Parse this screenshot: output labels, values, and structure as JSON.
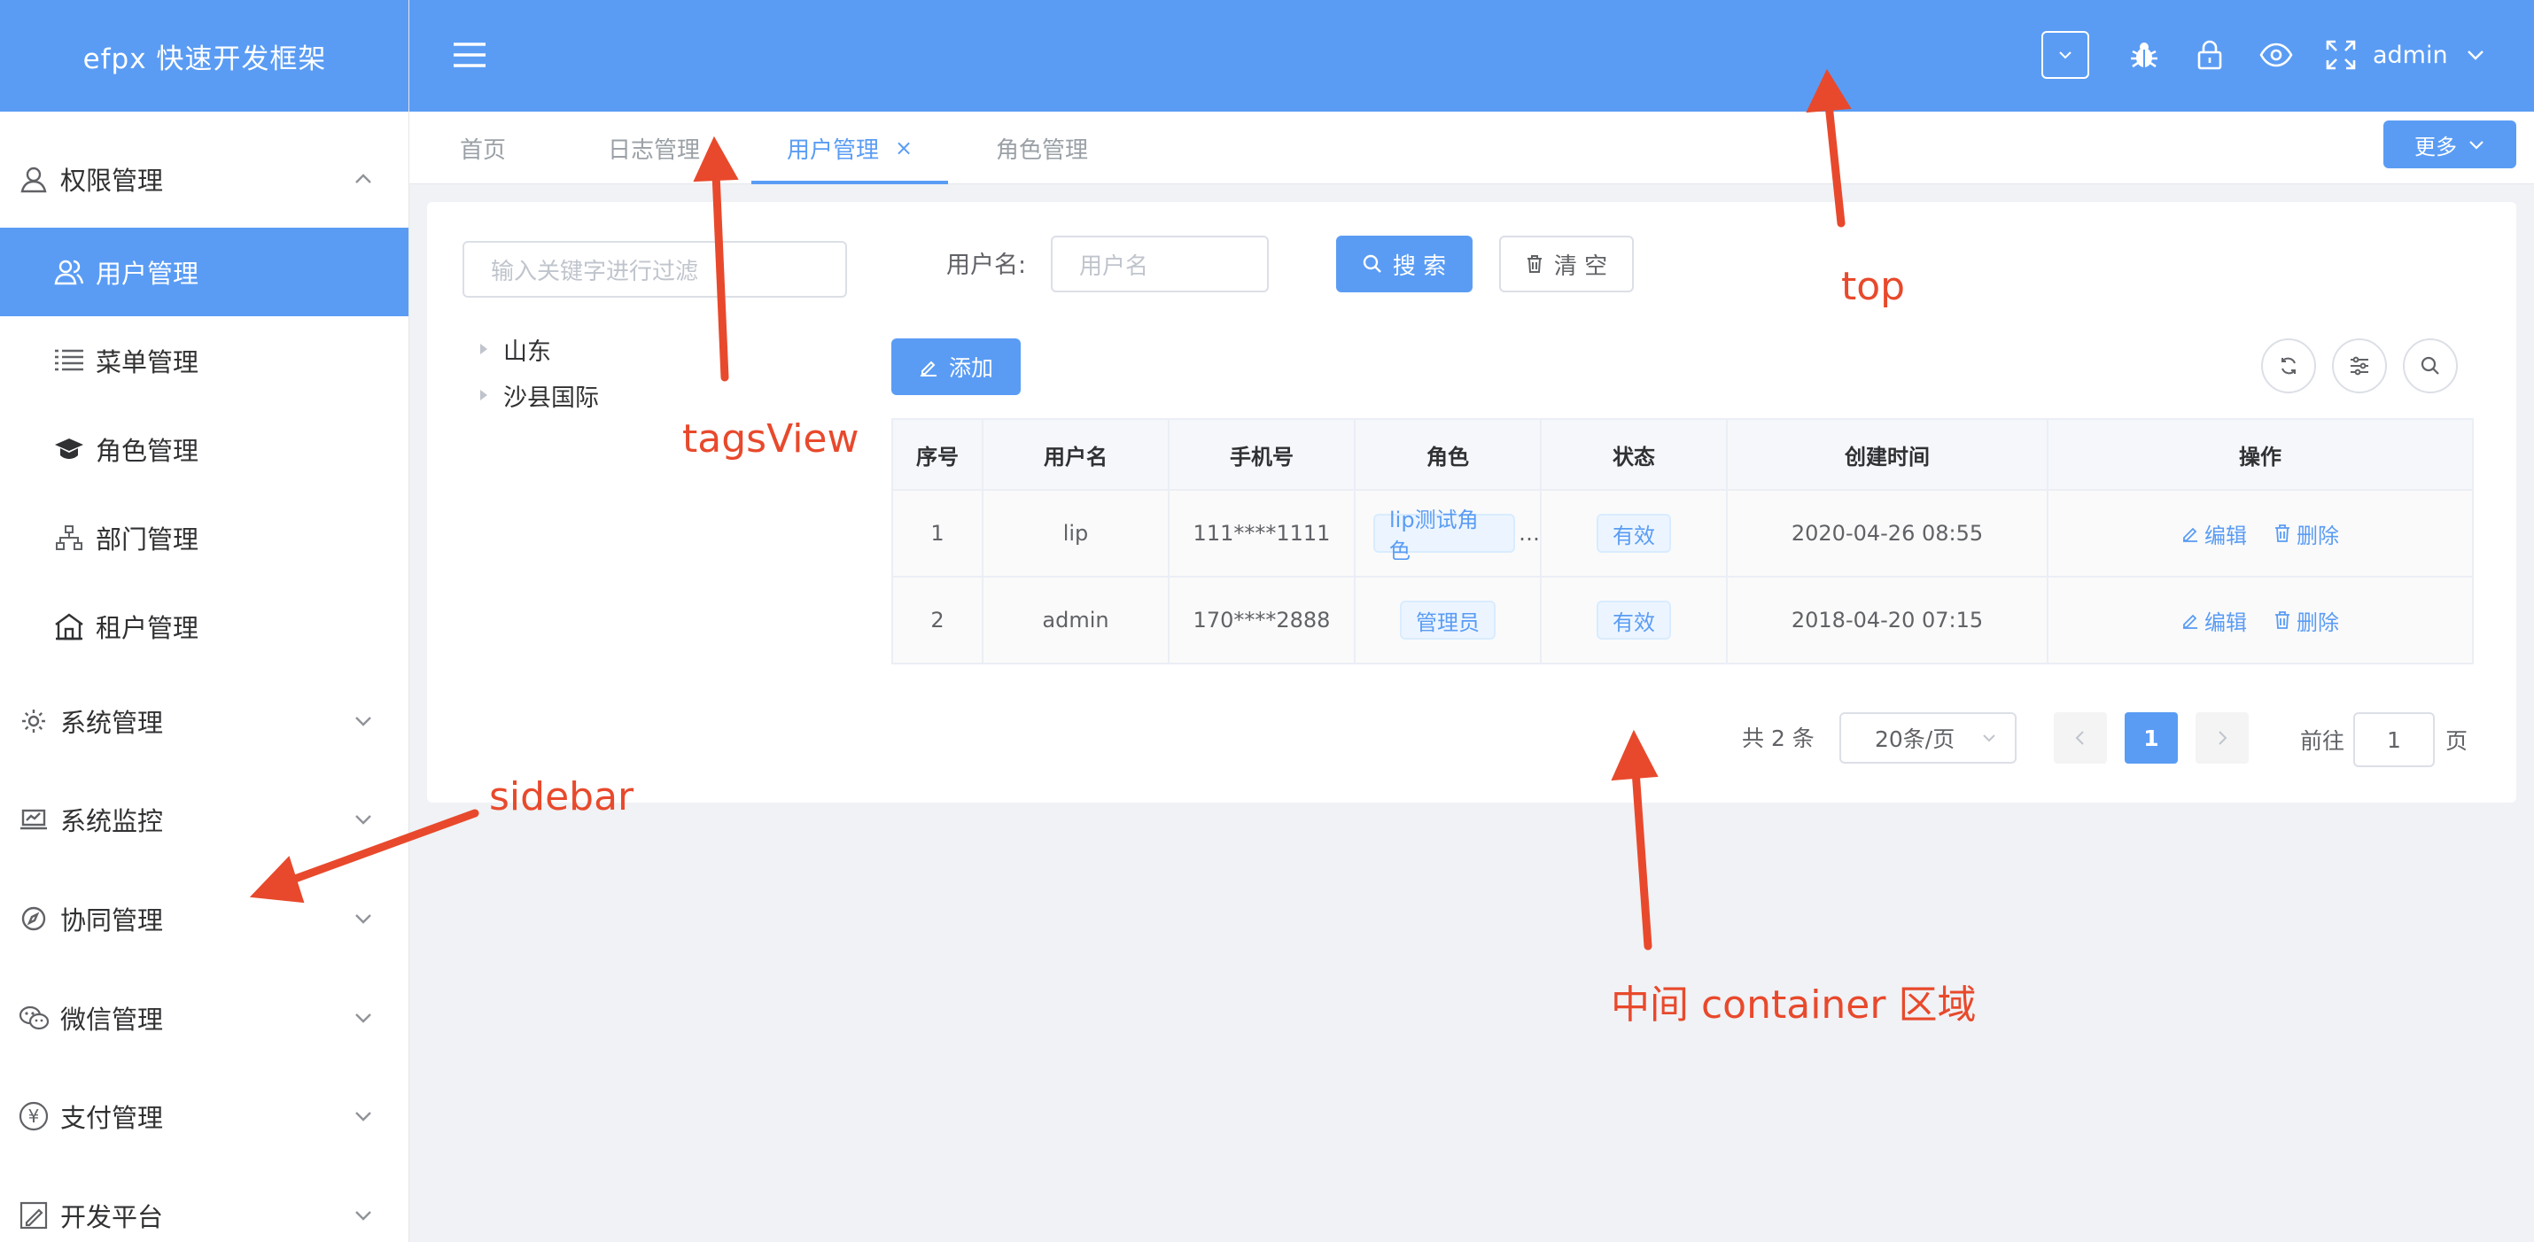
{
  "app": {
    "title": "efpx 快速开发框架"
  },
  "header": {
    "user": "admin"
  },
  "sidebar": {
    "items": [
      {
        "label": "权限管理",
        "icon": "user-icon",
        "expanded": true
      },
      {
        "label": "用户管理",
        "icon": "users-icon",
        "active": true
      },
      {
        "label": "菜单管理",
        "icon": "list-icon"
      },
      {
        "label": "角色管理",
        "icon": "graduation-cap-icon"
      },
      {
        "label": "部门管理",
        "icon": "org-chart-icon"
      },
      {
        "label": "租户管理",
        "icon": "house-icon"
      },
      {
        "label": "系统管理",
        "icon": "gear-icon"
      },
      {
        "label": "系统监控",
        "icon": "monitor-icon"
      },
      {
        "label": "协同管理",
        "icon": "compass-icon"
      },
      {
        "label": "微信管理",
        "icon": "wechat-icon"
      },
      {
        "label": "支付管理",
        "icon": "yen-icon"
      },
      {
        "label": "开发平台",
        "icon": "edit-box-icon"
      }
    ]
  },
  "tags": [
    {
      "label": "首页"
    },
    {
      "label": "日志管理"
    },
    {
      "label": "用户管理",
      "active": true,
      "close": "×"
    },
    {
      "label": "角色管理"
    }
  ],
  "more_label": "更多",
  "tree": {
    "filter_placeholder": "输入关键字进行过滤",
    "nodes": [
      "山东",
      "沙县国际"
    ]
  },
  "search": {
    "label": "用户名:",
    "placeholder": "用户名",
    "search_btn": "搜 索",
    "clear_btn": "清 空"
  },
  "toolbar": {
    "add_btn": "添加"
  },
  "table": {
    "columns": [
      "序号",
      "用户名",
      "手机号",
      "角色",
      "状态",
      "创建时间",
      "操作"
    ],
    "rows": [
      {
        "idx": "1",
        "username": "lip",
        "phone": "111****1111",
        "role": "lip测试角色",
        "role_more": "…",
        "status": "有效",
        "created": "2020-04-26 08:55",
        "edit": "编辑",
        "delete": "删除"
      },
      {
        "idx": "2",
        "username": "admin",
        "phone": "170****2888",
        "role": "管理员",
        "role_more": "",
        "status": "有效",
        "created": "2018-04-20 07:15",
        "edit": "编辑",
        "delete": "删除"
      }
    ]
  },
  "pagination": {
    "total": "共 2 条",
    "page_size": "20条/页",
    "current": "1",
    "goto_label": "前往",
    "goto_value": "1",
    "page_suffix": "页"
  },
  "annotations": {
    "top": "top",
    "tagsview": "tagsView",
    "sidebar": "sidebar",
    "container": "中间 container 区域"
  },
  "colors": {
    "primary": "#5a9cf4",
    "annotation": "#e8492c"
  }
}
